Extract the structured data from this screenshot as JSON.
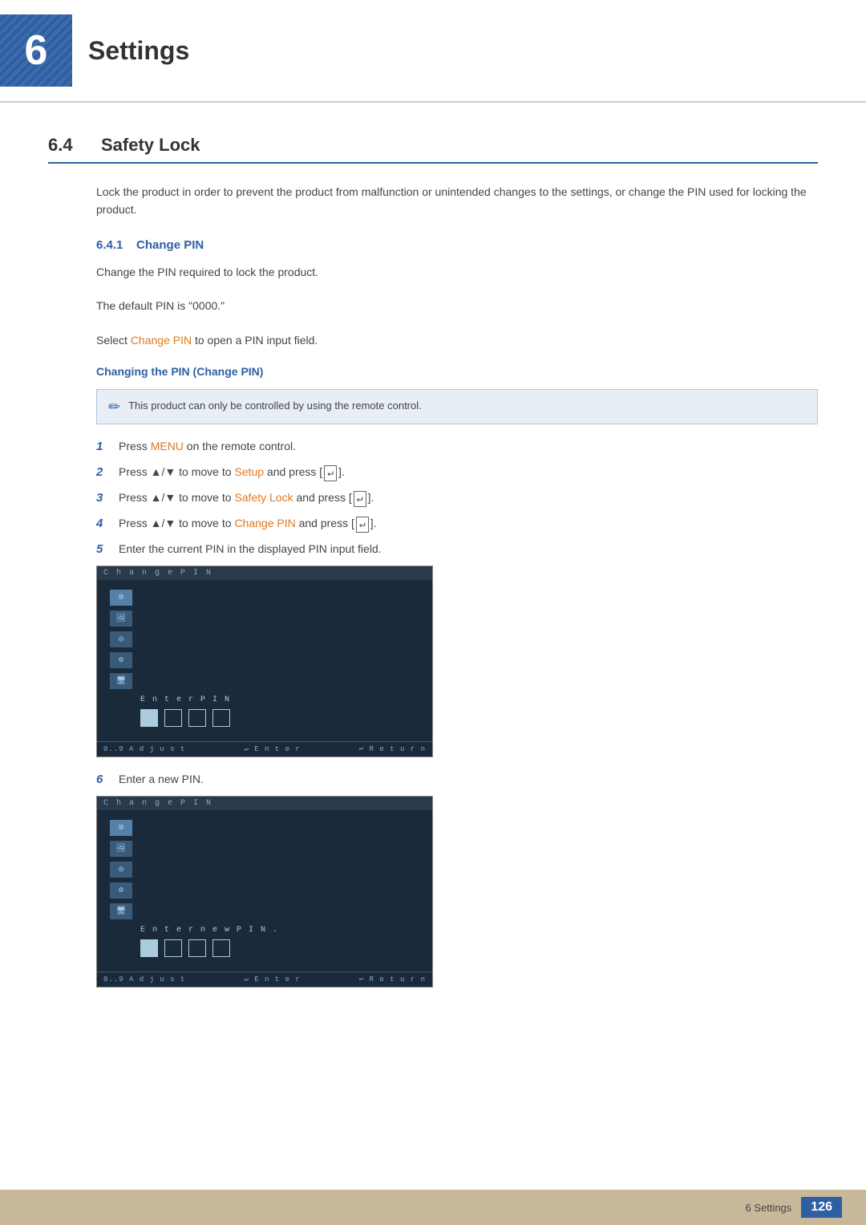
{
  "header": {
    "chapter_number": "6",
    "chapter_title": "Settings"
  },
  "section": {
    "number": "6.4",
    "title": "Safety Lock",
    "intro": "Lock the product in order to prevent the product from malfunction or unintended changes to the settings, or change the PIN used for locking the product.",
    "subsections": [
      {
        "number": "6.4.1",
        "title": "Change PIN",
        "description1": "Change the PIN required to lock the product.",
        "description2": "The default PIN is \"0000.\"",
        "description3_prefix": "Select ",
        "description3_link": "Change PIN",
        "description3_suffix": " to open a PIN input field.",
        "colored_heading": "Changing the PIN (Change PIN)",
        "note": "This product can only be controlled by using the remote control.",
        "steps": [
          {
            "num": "1",
            "text_prefix": "Press ",
            "highlight": "MENU",
            "text_suffix": " on the remote control."
          },
          {
            "num": "2",
            "text_prefix": "Press ▲/▼ to move to ",
            "highlight": "Setup",
            "text_suffix": " and press [↵]."
          },
          {
            "num": "3",
            "text_prefix": "Press ▲/▼ to move to ",
            "highlight": "Safety Lock",
            "text_suffix": " and press [↵]."
          },
          {
            "num": "4",
            "text_prefix": "Press ▲/▼ to move to ",
            "highlight": "Change PIN",
            "text_suffix": " and press [↵]."
          },
          {
            "num": "5",
            "text": "Enter the current PIN in the displayed PIN input field."
          },
          {
            "num": "6",
            "text": "Enter a new PIN."
          }
        ],
        "pin_screen1": {
          "bar_label": "C h a n g e P I N",
          "enter_label": "E n t e r  P I N",
          "footer_left": "0..9 A d j u s t",
          "footer_mid": "↵ E n t e r",
          "footer_right": "↩ R e t u r n"
        },
        "pin_screen2": {
          "bar_label": "C h a n g e P I N",
          "enter_label": "E n t e r  n e w  P I N .",
          "footer_left": "0..9 A d j u s t",
          "footer_mid": "↵ E n t e r",
          "footer_right": "↩ R e t u r n"
        }
      }
    ]
  },
  "footer": {
    "text": "6 Settings",
    "page": "126"
  }
}
